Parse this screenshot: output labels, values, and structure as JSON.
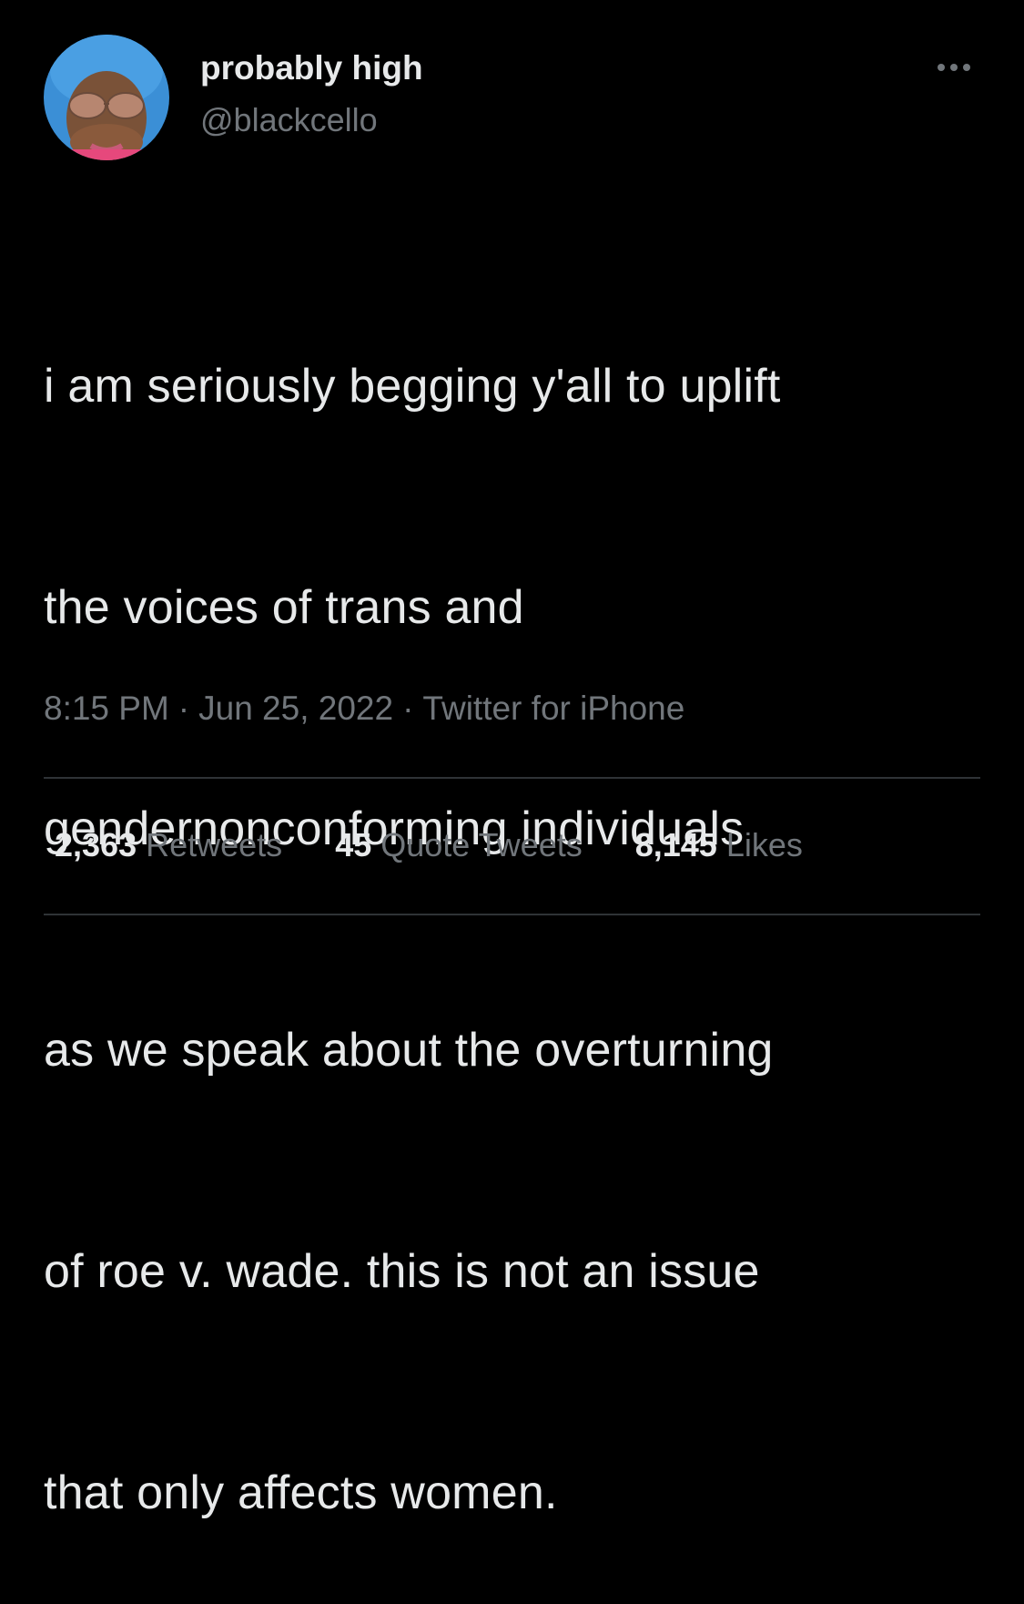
{
  "author": {
    "display_name": "probably high",
    "handle": "@blackcello",
    "avatar_icon": "profile-photo"
  },
  "header": {
    "more_icon": "more-horizontal-icon"
  },
  "tweet": {
    "lines": [
      "i am seriously begging y'all to uplift",
      "the voices of trans and",
      "gendernonconforming individuals",
      "as we speak about the overturning",
      "of roe v. wade. this is not an issue",
      "that only affects women."
    ]
  },
  "meta": {
    "time": "8:15 PM",
    "separator": "·",
    "date": "Jun 25, 2022",
    "source": "Twitter for iPhone"
  },
  "stats": {
    "retweets_count": "2,363",
    "retweets_label": "Retweets",
    "quotes_count": "45",
    "quotes_label": "Quote Tweets",
    "likes_count": "8,145",
    "likes_label": "Likes"
  },
  "colors": {
    "background": "#000000",
    "primary_text": "#e7e9ea",
    "secondary_text": "#71767b",
    "divider": "#2f3336"
  }
}
